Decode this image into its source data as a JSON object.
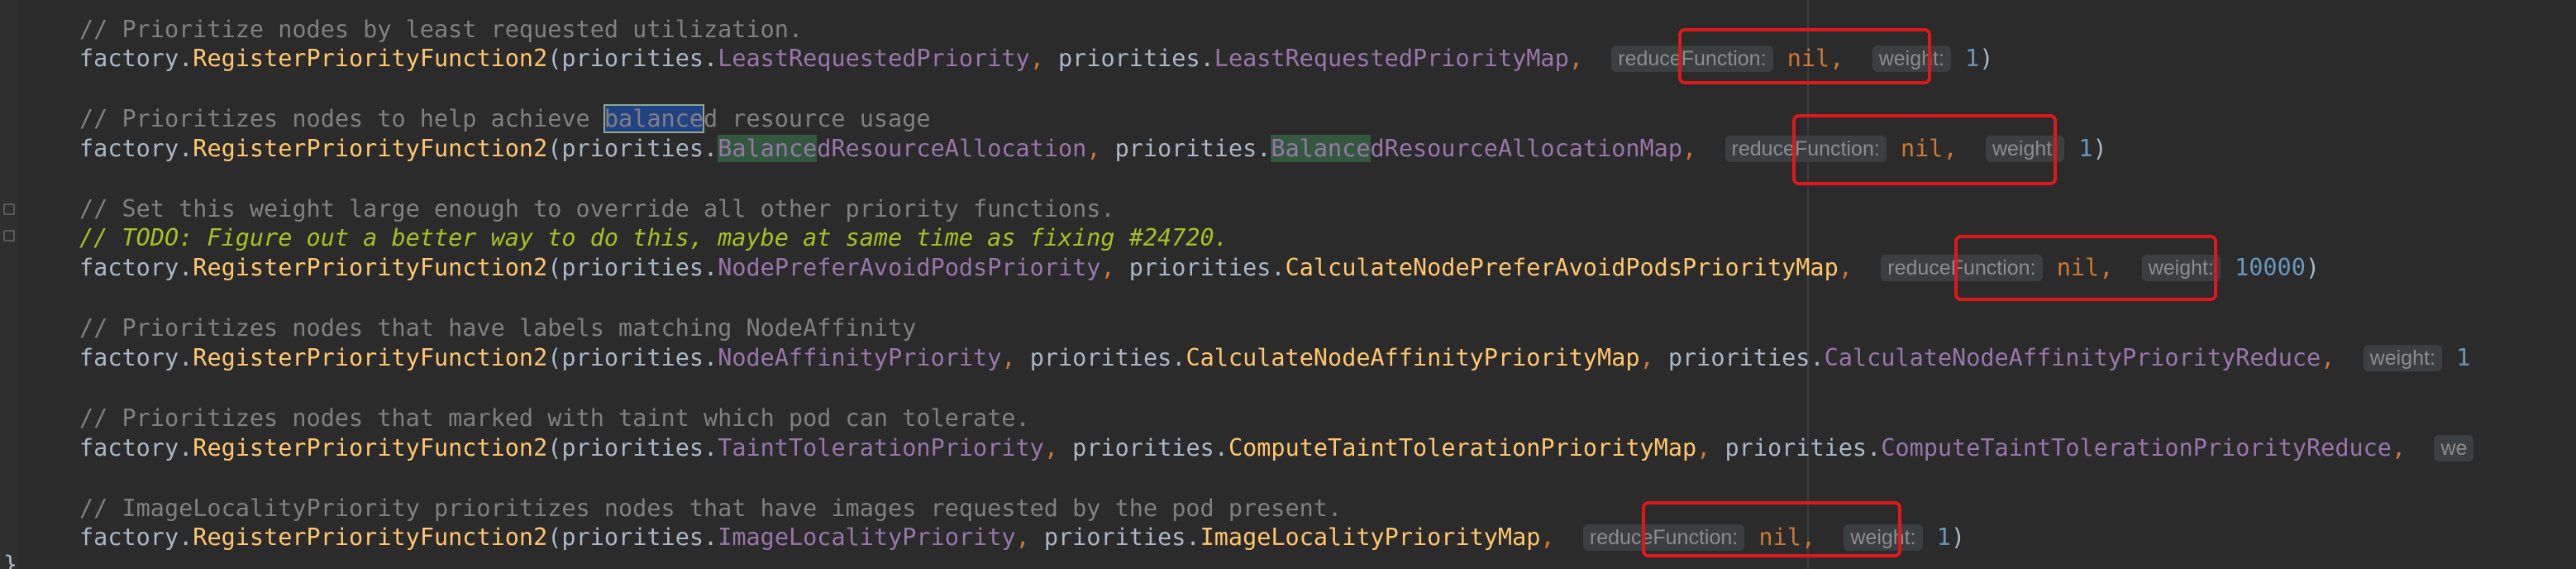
{
  "comments": {
    "c1": "// Prioritize nodes by least requested utilization.",
    "c2_pre": "// Prioritizes nodes to help achieve ",
    "c2_sel": "balance",
    "c2_post": "d resource usage",
    "c3": "// Set this weight large enough to override all other priority functions.",
    "c4": "// TODO: Figure out a better way to do this, maybe at same time as fixing #24720.",
    "c5": "// Prioritizes nodes that have labels matching NodeAffinity",
    "c6": "// Prioritizes nodes that marked with taint which pod can tolerate.",
    "c7": "// ImageLocalityPriority prioritizes nodes that have images requested by the pod present."
  },
  "tokens": {
    "factory": "factory",
    "dot": ".",
    "register": "RegisterPriorityFunction2",
    "open_paren": "(",
    "priorities": "priorities",
    "comma_sp": ", ",
    "comma": ",",
    "close_paren": ")",
    "nil": "nil",
    "balanced_hl": "Balance",
    "closing_brace": "}"
  },
  "fields": {
    "least_requested": "LeastRequestedPriority",
    "least_requested_map": "LeastRequestedPriorityMap",
    "balanced_rest": "dResourceAllocation",
    "balanced_map_rest": "dResourceAllocationMap",
    "node_prefer_avoid": "NodePreferAvoidPodsPriority",
    "calc_node_prefer_avoid_map": "CalculateNodePreferAvoidPodsPriorityMap",
    "node_affinity": "NodeAffinityPriority",
    "calc_node_affinity_map": "CalculateNodeAffinityPriorityMap",
    "calc_node_affinity_reduce": "CalculateNodeAffinityPriorityReduce",
    "taint_toleration": "TaintTolerationPriority",
    "compute_taint_map": "ComputeTaintTolerationPriorityMap",
    "compute_taint_reduce": "ComputeTaintTolerationPriorityReduce",
    "image_locality": "ImageLocalityPriority",
    "image_locality_map": "ImageLocalityPriorityMap"
  },
  "hints": {
    "reduce_function": "reduceFunction:",
    "weight": "weight:",
    "weight_truncated": "we"
  },
  "values": {
    "weight_1": "1",
    "weight_10000": "10000",
    "weight_1_cut": "1"
  },
  "colors": {
    "background": "#2b2b2b",
    "text": "#a9b7c6",
    "comment": "#808080",
    "todo": "#a8c023",
    "function": "#ffc66d",
    "field": "#9876aa",
    "keyword_punct": "#cc7832",
    "number": "#6897bb",
    "inlay_hint_bg": "#3b3f42",
    "annotation_box": "#e0181c"
  }
}
